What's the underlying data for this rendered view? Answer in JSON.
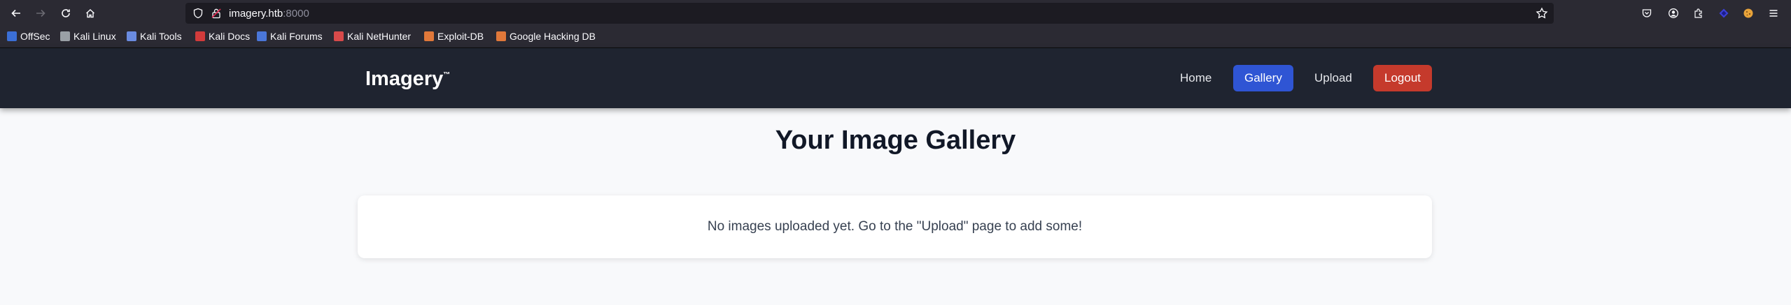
{
  "browser": {
    "url_host": "imagery.htb",
    "url_port": ":8000",
    "bookmarks": [
      {
        "label": "OffSec",
        "icon": "offsec-icon",
        "color": "#3b6fd6"
      },
      {
        "label": "Kali Linux",
        "icon": "kali-dragon-icon",
        "color": "#9aa0a6"
      },
      {
        "label": "Kali Tools",
        "icon": "kali-tools-icon",
        "color": "#6a8be0"
      },
      {
        "label": "Kali Docs",
        "icon": "kali-docs-icon",
        "color": "#d23b3b"
      },
      {
        "label": "Kali Forums",
        "icon": "kali-forums-icon",
        "color": "#4a76d8"
      },
      {
        "label": "Kali NetHunter",
        "icon": "nethunter-icon",
        "color": "#d84a4a"
      },
      {
        "label": "Exploit-DB",
        "icon": "exploit-db-icon",
        "color": "#e0783a"
      },
      {
        "label": "Google Hacking DB",
        "icon": "ghdb-icon",
        "color": "#e0783a"
      }
    ]
  },
  "site": {
    "brand": "Imagery",
    "brand_mark": "™",
    "nav": {
      "home": "Home",
      "gallery": "Gallery",
      "upload": "Upload",
      "logout": "Logout"
    },
    "colors": {
      "nav_bg": "#1f2430",
      "active": "#2f55d4",
      "logout": "#c53a2c"
    }
  },
  "gallery": {
    "title": "Your Image Gallery",
    "empty_message": "No images uploaded yet. Go to the \"Upload\" page to add some!"
  }
}
